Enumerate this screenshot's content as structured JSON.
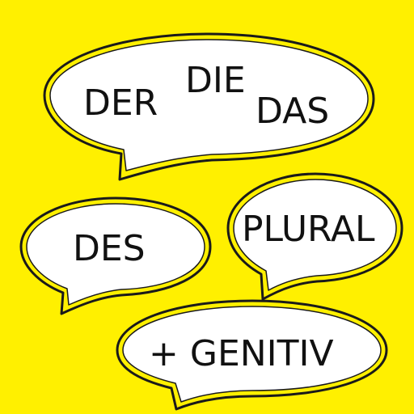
{
  "colors": {
    "background": "#FFF000",
    "bubble_fill": "#FFFFFF",
    "bubble_outline": "#1A1A1A",
    "bubble_inner_ring": "#FFF000",
    "text": "#111111"
  },
  "bubbles": [
    {
      "id": "top",
      "tail": "bottom-left"
    },
    {
      "id": "middle-left",
      "tail": "bottom-left"
    },
    {
      "id": "middle-right",
      "tail": "bottom-left"
    },
    {
      "id": "bottom",
      "tail": "bottom-left"
    }
  ],
  "words": {
    "der": "DER",
    "die": "DIE",
    "das": "DAS",
    "des": "DES",
    "plural": "PLURAL",
    "genitiv": "+  GENITIV"
  }
}
